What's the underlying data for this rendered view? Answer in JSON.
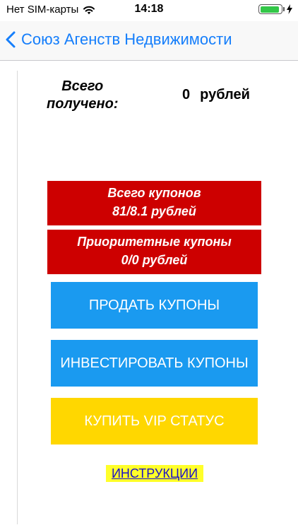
{
  "status_bar": {
    "carrier": "Нет SIM-карты",
    "time": "14:18",
    "battery_level": 0.92,
    "battery_color": "#33c748"
  },
  "nav": {
    "back_icon": "chevron-left-icon",
    "title": "Союз Агенств Недвижимости",
    "accent_color": "#157efb"
  },
  "summary": {
    "total_received_label": "Всего\nполучено:",
    "total_received_amount": "0",
    "total_received_currency": "рублей"
  },
  "cards": {
    "coupons_title": "Всего купонов",
    "coupons_value": "81/8.1 рублей",
    "priority_title": "Приоритетные купоны",
    "priority_value": "0/0 рублей",
    "card_color": "#cd0000"
  },
  "actions": {
    "sell_label": "ПРОДАТЬ КУПОНЫ",
    "invest_label": "ИНВЕСТИРОВАТЬ КУПОНЫ",
    "vip_label": "КУПИТЬ VIP СТАТУС",
    "blue_color": "#1a9af0",
    "yellow_color": "#ffd700"
  },
  "footer": {
    "instructions_label": "ИНСТРУКЦИИ"
  }
}
